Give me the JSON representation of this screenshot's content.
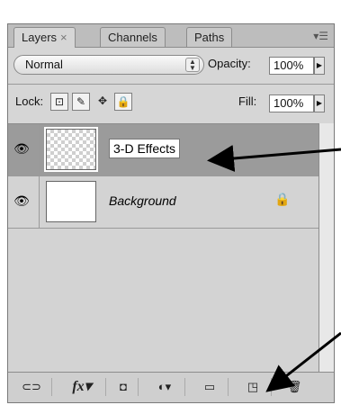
{
  "tabs": [
    {
      "label": "Layers",
      "close": "×",
      "active": true
    },
    {
      "label": "Channels",
      "active": false
    },
    {
      "label": "Paths",
      "active": false
    }
  ],
  "panel_menu_icon": "panel-menu-icon",
  "blend_mode": {
    "selected": "Normal"
  },
  "opacity": {
    "label": "Opacity:",
    "value": "100%"
  },
  "lock": {
    "label": "Lock:"
  },
  "fill": {
    "label": "Fill:",
    "value": "100%"
  },
  "layers": [
    {
      "name": "3-D Effects",
      "selected": true,
      "transparent": true,
      "locked": false
    },
    {
      "name": "Background",
      "selected": false,
      "transparent": false,
      "locked": true
    }
  ],
  "footer": {
    "fx_label": "fx"
  },
  "colors": {
    "panel_bg": "#d6d6d6",
    "selected_row": "#9b9b9b",
    "arrow": "#000000"
  }
}
